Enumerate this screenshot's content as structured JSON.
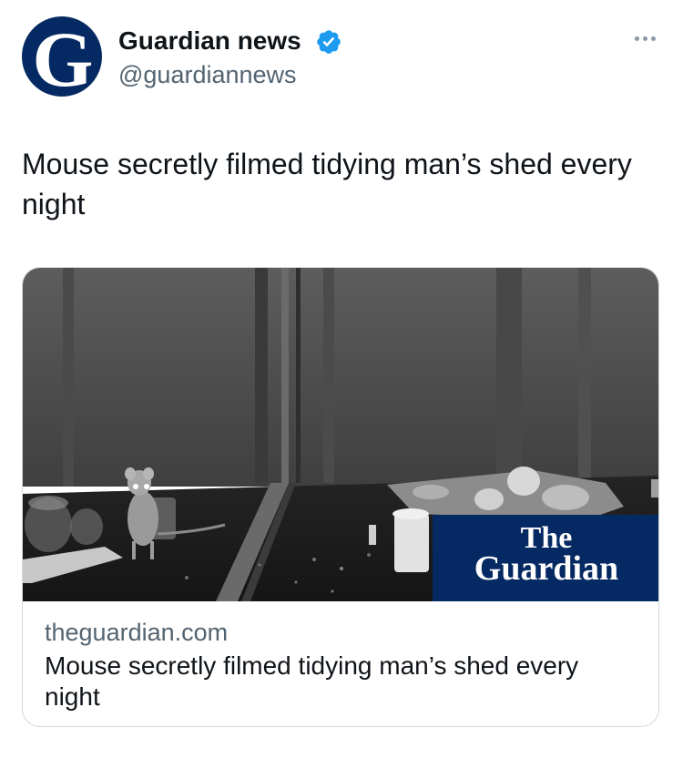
{
  "author": {
    "display_name": "Guardian news",
    "handle": "@guardiannews",
    "avatar_letter": "G",
    "verified": true,
    "verified_icon": "verified-badge-icon"
  },
  "more_icon": "more-options-icon",
  "tweet": {
    "text": "Mouse secretly filmed tidying man’s shed every night"
  },
  "card": {
    "domain": "theguardian.com",
    "title": "Mouse secretly filmed tidying man’s shed every night",
    "image_logo_line1": "The",
    "image_logo_line2": "Guardian"
  },
  "colors": {
    "guardian_blue": "#052962",
    "verified_blue": "#1d9bf0",
    "secondary_text": "#536471",
    "primary_text": "#0f1419"
  }
}
